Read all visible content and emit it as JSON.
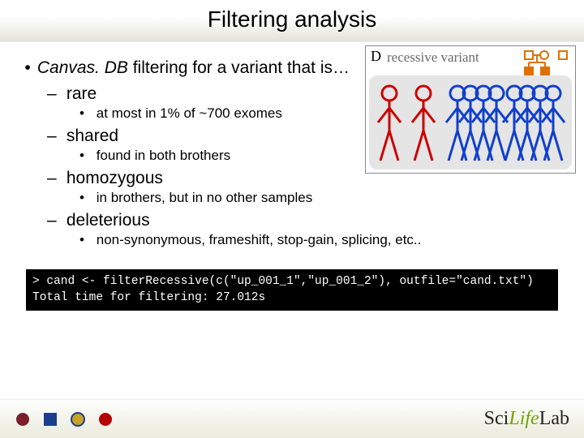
{
  "title": "Filtering analysis",
  "intro": {
    "emph": "Canvas. DB",
    "rest": " filtering for a variant that is…"
  },
  "criteria": [
    {
      "label": "rare",
      "detail": "at most in 1% of ~700 exomes"
    },
    {
      "label": "shared",
      "detail": "found in both brothers"
    },
    {
      "label": "homozygous",
      "detail": "in brothers, but in no other samples"
    },
    {
      "label": "deleterious",
      "detail": "non-synonymous, frameshift, stop-gain, splicing, etc.."
    }
  ],
  "figure": {
    "panel_letter": "D",
    "caption": "recessive variant"
  },
  "terminal": {
    "line1": "> cand <- filterRecessive(c(\"up_001_1\",\"up_001_2\"), outfile=\"cand.txt\")",
    "line2": "Total time for filtering: 27.012s"
  },
  "footer": {
    "lab_name_prefix": "Sci",
    "lab_name_mid": "Life",
    "lab_name_suffix": "Lab"
  }
}
